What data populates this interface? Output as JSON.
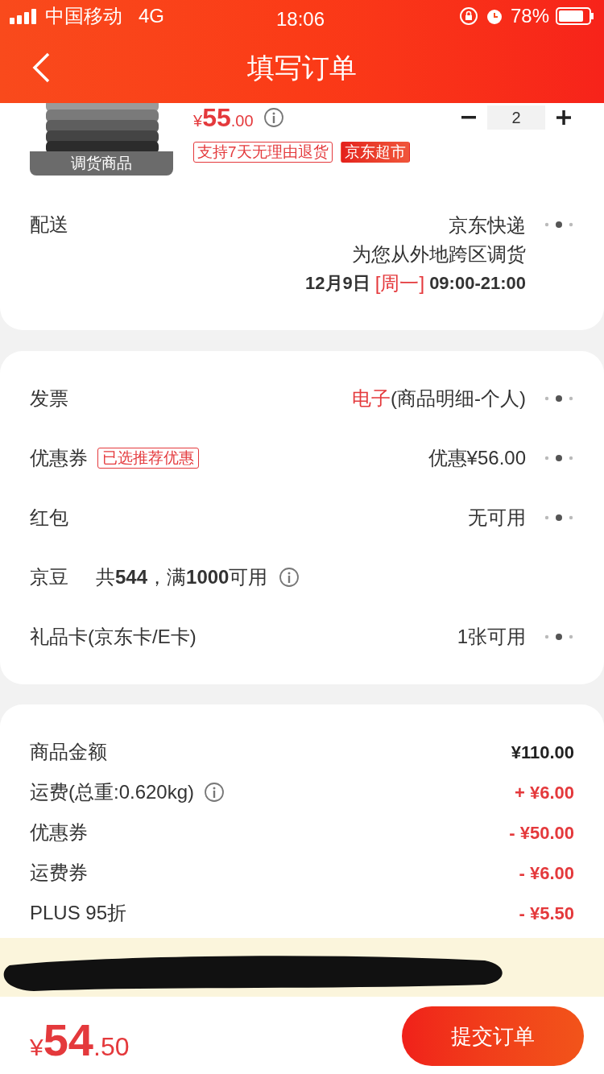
{
  "status_bar": {
    "carrier": "中国移动",
    "network": "4G",
    "time": "18:06",
    "battery": "78%"
  },
  "header": {
    "title": "填写订单"
  },
  "product": {
    "price_symbol": "¥",
    "price_int": "55",
    "price_dec": ".00",
    "quantity": "2",
    "badge": "调货商品",
    "tags": [
      {
        "text": "支持7天无理由退货",
        "kind": "outline"
      },
      {
        "text": "京东超市",
        "kind": "filled"
      }
    ]
  },
  "delivery": {
    "label": "配送",
    "method": "京东快递",
    "note": "为您从外地跨区调货",
    "date": "12月9日",
    "weekday": "[周一]",
    "time_window": "09:00-21:00"
  },
  "options": [
    {
      "label": "发票",
      "value_highlight": "电子",
      "value": "(商品明细-个人)",
      "more": true
    },
    {
      "label": "优惠券",
      "badge": "已选推荐优惠",
      "value": "优惠¥56.00",
      "more": true
    },
    {
      "label": "红包",
      "value": "无可用",
      "more": true
    },
    {
      "label": "京豆",
      "detail": "共**544**，满**1000**可用",
      "info": true,
      "more": false
    },
    {
      "label": "礼品卡(京东卡/E卡)",
      "value": "1张可用",
      "more": true
    }
  ],
  "summary": [
    {
      "label": "商品金额",
      "amount": "¥110.00",
      "highlighted": false
    },
    {
      "label": "运费(总重:0.620kg)",
      "info": true,
      "amount": "+ ¥6.00",
      "highlighted": true
    },
    {
      "label": "优惠券",
      "amount": "- ¥50.00",
      "highlighted": true
    },
    {
      "label": "运费券",
      "amount": "- ¥6.00",
      "highlighted": true
    },
    {
      "label": "PLUS 95折",
      "amount": "- ¥5.50",
      "highlighted": true
    }
  ],
  "footer": {
    "total_symbol": "¥",
    "total_int": "54",
    "total_dec": ".50",
    "submit": "提交订单"
  }
}
